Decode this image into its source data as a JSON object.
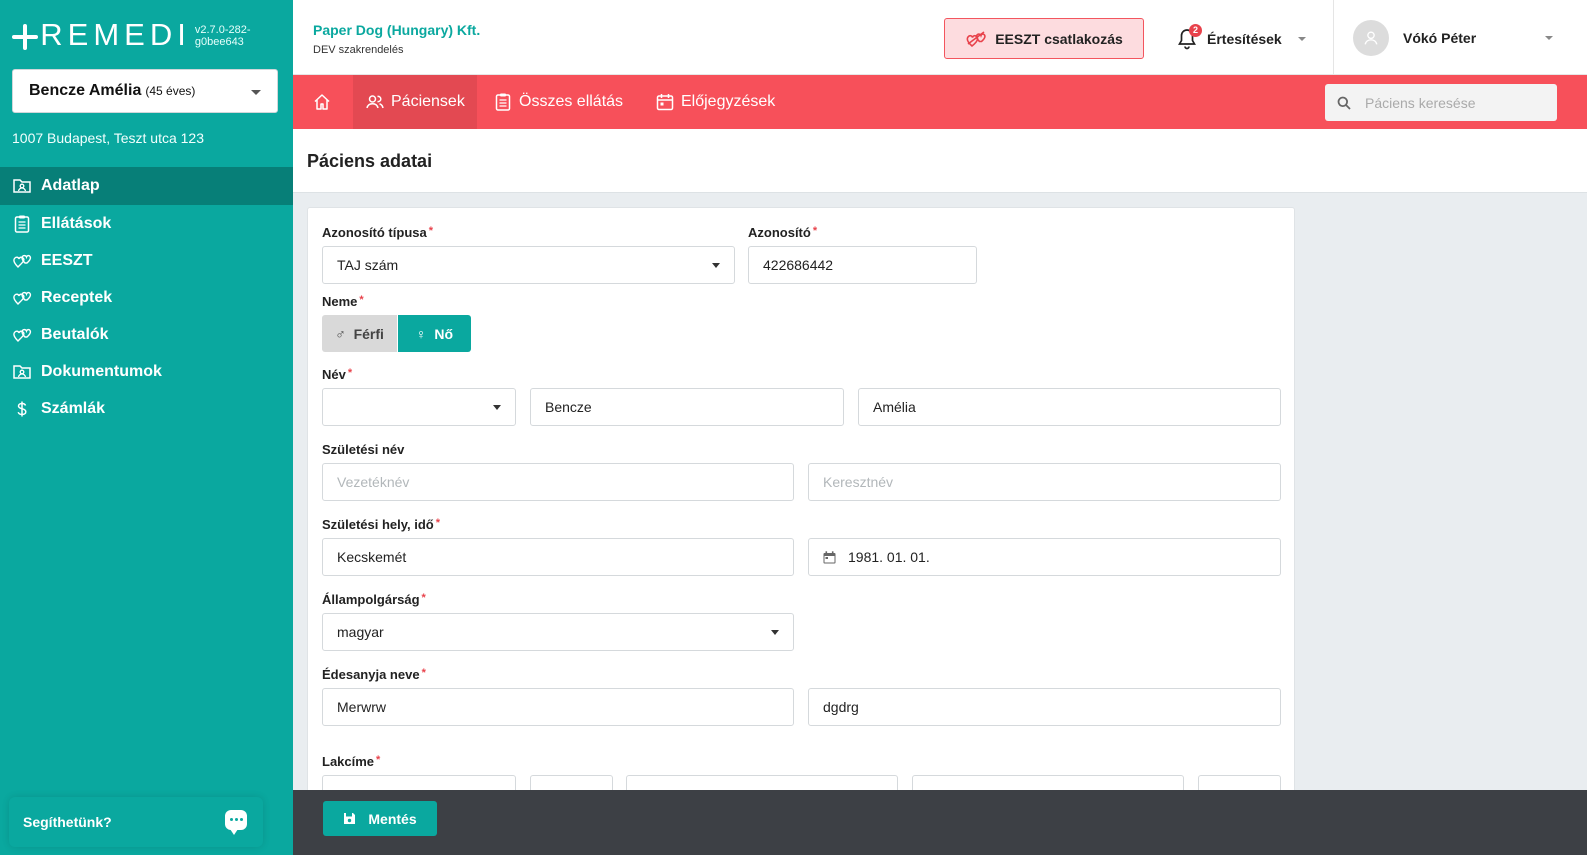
{
  "app": {
    "logo_text": "REMEDI",
    "version": "v2.7.0-282-g0bee643"
  },
  "sidebar": {
    "patient": {
      "name": "Bencze Amélia",
      "age": "(45 éves)"
    },
    "address": "1007 Budapest, Teszt utca 123",
    "items": [
      {
        "label": "Adatlap",
        "icon": "folder-user-icon",
        "active": true
      },
      {
        "label": "Ellátások",
        "icon": "clipboard-icon",
        "active": false
      },
      {
        "label": "EESZT",
        "icon": "eeszt-hearts-icon",
        "active": false
      },
      {
        "label": "Receptek",
        "icon": "eeszt-hearts-icon",
        "active": false
      },
      {
        "label": "Beutalók",
        "icon": "eeszt-hearts-icon",
        "active": false
      },
      {
        "label": "Dokumentumok",
        "icon": "folder-user-icon",
        "active": false
      },
      {
        "label": "Számlák",
        "icon": "dollar-icon",
        "active": false
      }
    ],
    "help": "Segíthetünk?"
  },
  "header": {
    "org_name": "Paper Dog (Hungary) Kft.",
    "org_sub": "DEV szakrendelés",
    "eeszt_button": "EESZT csatlakozás",
    "notifications_label": "Értesítések",
    "notifications_count": "2",
    "user_name": "Vókó Péter"
  },
  "tabs": [
    {
      "label": "",
      "icon": "home-icon"
    },
    {
      "label": "Páciensek",
      "icon": "users-icon",
      "active": true
    },
    {
      "label": "Összes ellátás",
      "icon": "clipboard-icon"
    },
    {
      "label": "Előjegyzések",
      "icon": "calendar-icon"
    }
  ],
  "search": {
    "placeholder": "Páciens keresése"
  },
  "page": {
    "title": "Páciens adatai"
  },
  "form": {
    "id_type_label": "Azonosító típusa",
    "id_type_value": "TAJ szám",
    "id_label": "Azonosító",
    "id_value": "422686442",
    "gender_label": "Neme",
    "gender_male": "Férfi",
    "gender_female": "Nő",
    "gender_selected": "Nő",
    "name_label": "Név",
    "name_prefix": "",
    "last_name": "Bencze",
    "first_name": "Amélia",
    "birth_name_label": "Születési név",
    "birth_last_placeholder": "Vezetéknév",
    "birth_first_placeholder": "Keresztnév",
    "birth_place_label": "Születési hely, idő",
    "birth_place": "Kecskemét",
    "birth_date": "1981. 01. 01.",
    "citizenship_label": "Állampolgárság",
    "citizenship": "magyar",
    "mother_label": "Édesanyja neve",
    "mother_last": "Merwrw",
    "mother_first": "dgdrg",
    "address_label": "Lakcíme"
  },
  "footer": {
    "save_label": "Mentés"
  },
  "colors": {
    "teal": "#0aa89f",
    "red": "#f7505a",
    "dark": "#3d4045"
  }
}
